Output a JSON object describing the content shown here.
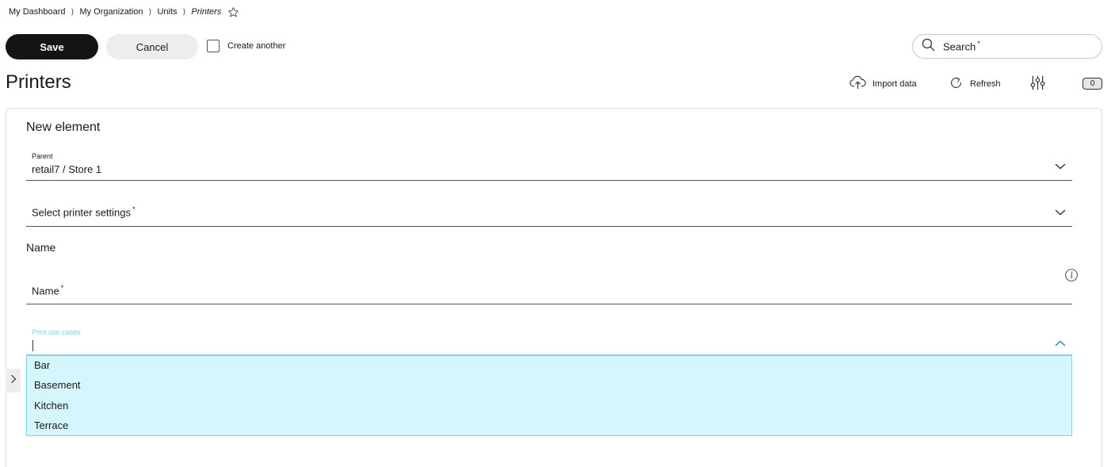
{
  "breadcrumb": {
    "items": [
      "My Dashboard",
      "My Organization",
      "Units"
    ],
    "current": "Printers",
    "separator": "⟩"
  },
  "toolbar": {
    "save_label": "Save",
    "cancel_label": "Cancel",
    "create_another_label": "Create another",
    "create_another_checked": false
  },
  "search": {
    "label": "Search",
    "required_marker": "*"
  },
  "page": {
    "title": "Printers"
  },
  "actions": {
    "import_label": "Import data",
    "refresh_label": "Refresh",
    "count": "0"
  },
  "form": {
    "title": "New element",
    "parent": {
      "label": "Parent",
      "value": "retail7 / Store 1"
    },
    "printer_settings": {
      "label": "Select printer settings",
      "required_marker": "*"
    },
    "name_section": "Name",
    "name_field": {
      "label": "Name",
      "required_marker": "*"
    },
    "use_cases": {
      "label": "Print use cases",
      "options": [
        "Bar",
        "Basement",
        "Kitchen",
        "Terrace"
      ]
    }
  },
  "colors": {
    "primary_button": "#141414",
    "secondary_button": "#ededed",
    "dropdown_bg": "#d6f6fd",
    "dropdown_border": "#7fd5e3",
    "accent_label": "#7fcfd8",
    "accent_chevron": "#2a8aa0"
  },
  "icons": {
    "favorite": "star-outline-icon",
    "search": "magnifier-icon",
    "import": "cloud-upload-icon",
    "refresh": "refresh-icon",
    "filters": "sliders-icon",
    "info": "info-circle-icon",
    "dropdown": "chevron-down-icon",
    "dropdown_open": "chevron-up-icon",
    "side_panel": "chevron-right-icon"
  }
}
